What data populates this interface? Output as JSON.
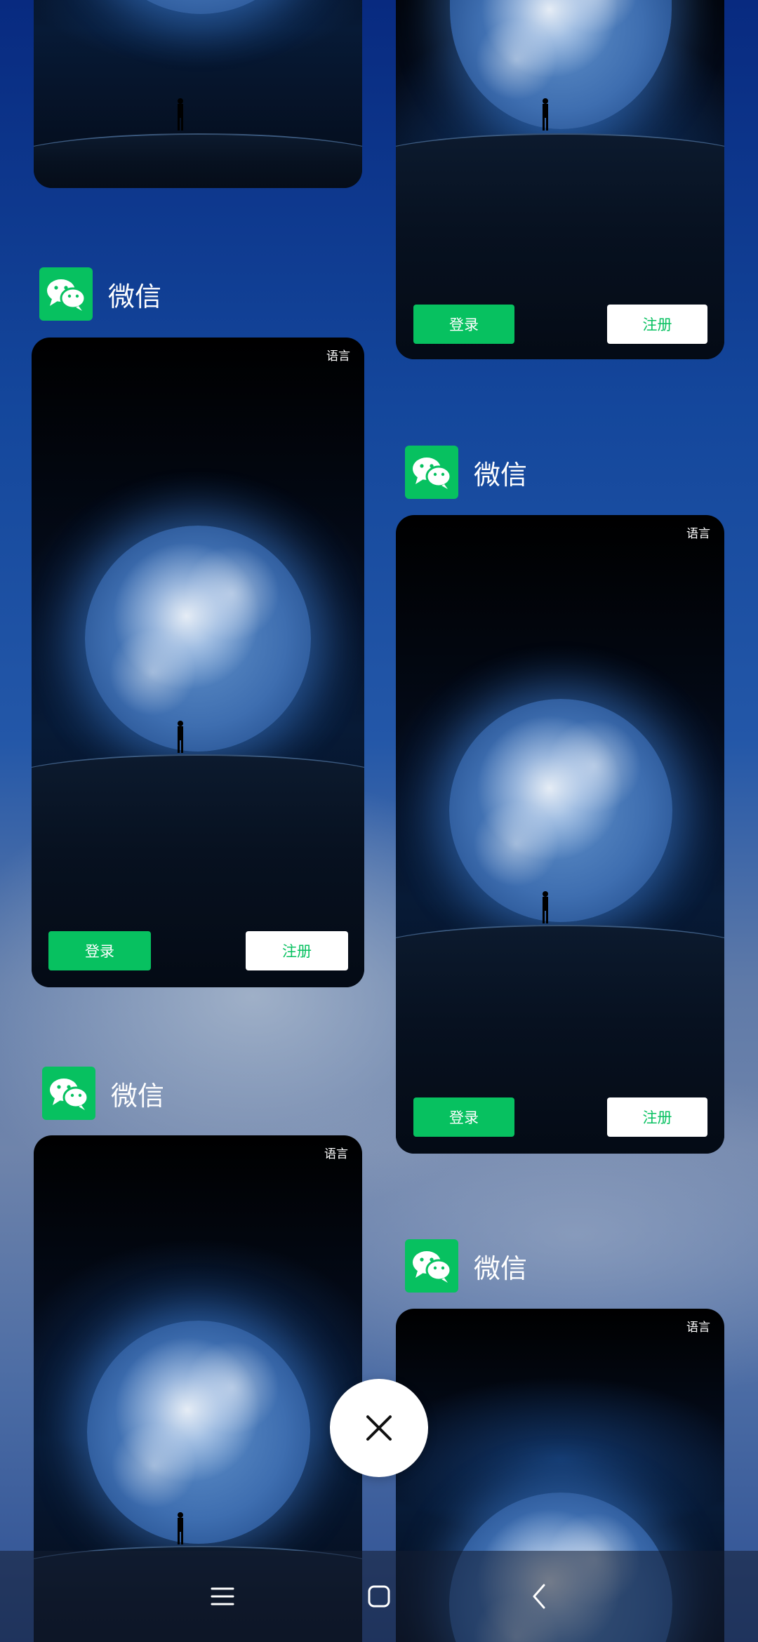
{
  "app": {
    "name": "微信",
    "icon": "wechat-icon",
    "brand_color": "#07c160"
  },
  "screen": {
    "language_label": "语言",
    "login_label": "登录",
    "register_label": "注册"
  },
  "controls": {
    "close_icon": "close-icon",
    "nav": [
      "menu-icon",
      "home-icon",
      "back-icon"
    ]
  }
}
